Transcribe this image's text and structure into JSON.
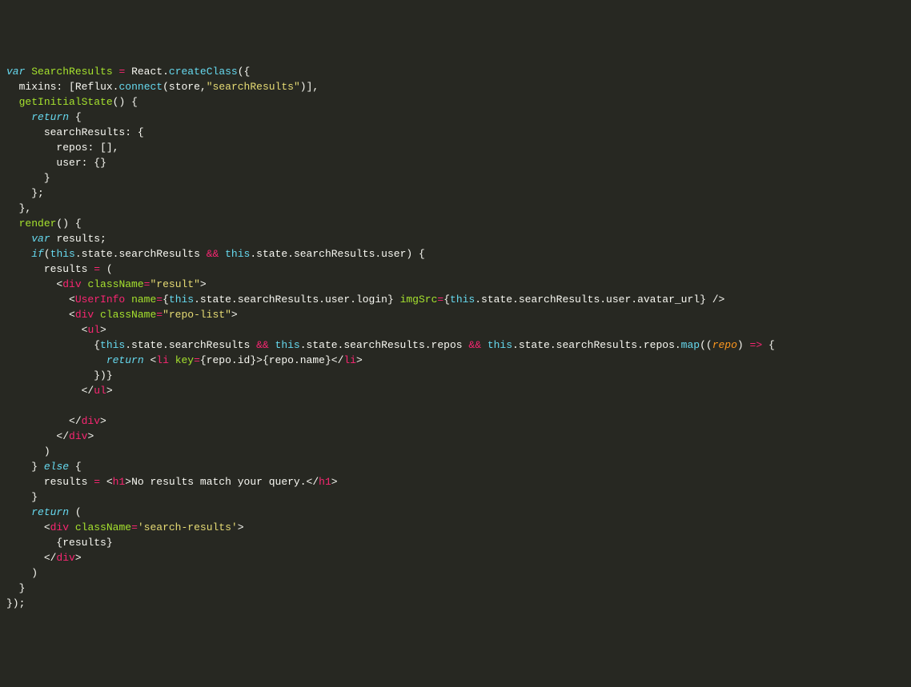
{
  "code": {
    "l1": {
      "var": "var",
      "name": "SearchResults",
      "eq": "=",
      "obj": "React",
      "dot": ".",
      "method": "createClass",
      "open": "({"
    },
    "l2": {
      "key": "mixins",
      "colon": ":",
      "open": "[",
      "obj": "Reflux",
      "dot": ".",
      "method": "connect",
      "p1": "store",
      "comma": ",",
      "str": "\"searchResults\"",
      "close": ")],"
    },
    "l3": {
      "name": "getInitialState",
      "paren": "()",
      "brace": "{"
    },
    "l4": {
      "return": "return",
      "brace": "{"
    },
    "l5": {
      "key": "searchResults",
      "colon": ":",
      "brace": "{"
    },
    "l6": {
      "key": "repos",
      "colon": ":",
      "val": "[],"
    },
    "l7": {
      "key": "user",
      "colon": ":",
      "val": "{}"
    },
    "l8": {
      "brace": "}"
    },
    "l9": {
      "brace": "};"
    },
    "l10": {
      "brace": "},"
    },
    "l11": {
      "name": "render",
      "paren": "()",
      "brace": "{"
    },
    "l12": {
      "var": "var",
      "name": "results",
      "semi": ";"
    },
    "l13": {
      "if": "if",
      "open": "(",
      "this1": "this",
      "p1": ".state.searchResults",
      "amp": "&&",
      "this2": "this",
      "p2": ".state.searchResults.user",
      ") {": ") {"
    },
    "l14": {
      "lhs": "results",
      "eq": "=",
      "open": "("
    },
    "l15": {
      "lt": "<",
      "tag": "div",
      "attr": "className",
      "eq": "=",
      "str": "\"result\"",
      "gt": ">"
    },
    "l16": {
      "lt": "<",
      "tag": "UserInfo",
      "attr1": "name",
      "eq1": "=",
      "b1": "{",
      "this1": "this",
      "p1": ".state.searchResults.user.login}",
      "attr2": "imgSrc",
      "eq2": "=",
      "b2": "{",
      "this2": "this",
      "p2": ".state.searchResults.user.avatar_url}",
      "close": "/>"
    },
    "l17": {
      "lt": "<",
      "tag": "div",
      "attr": "className",
      "eq": "=",
      "str": "\"repo-list\"",
      "gt": ">"
    },
    "l18": {
      "lt": "<",
      "tag": "ul",
      "gt": ">"
    },
    "l19": {
      "open": "{",
      "this1": "this",
      "p1": ".state.searchResults",
      "amp1": "&&",
      "this2": "this",
      "p2": ".state.searchResults.repos",
      "amp2": "&&",
      "this3": "this",
      "p3": ".state.searchResults.repos.",
      "map": "map",
      "paren": "((",
      "param": "repo",
      "close": ")",
      "arrow": "=>",
      "brace": "{"
    },
    "l20": {
      "return": "return",
      "lt": "<",
      "tag": "li",
      "attr": "key",
      "eq": "=",
      "b": "{repo.id}",
      "gt": ">",
      "txt": "{repo.name}",
      "lt2": "</",
      "tag2": "li",
      "gt2": ">"
    },
    "l21": {
      "close": "})}"
    },
    "l22": {
      "lt": "</",
      "tag": "ul",
      "gt": ">"
    },
    "l23": {
      "blank": ""
    },
    "l24": {
      "lt": "</",
      "tag": "div",
      "gt": ">"
    },
    "l25": {
      "lt": "</",
      "tag": "div",
      "gt": ">"
    },
    "l26": {
      "close": ")"
    },
    "l27": {
      "close": "}",
      "else": "else",
      "open": "{"
    },
    "l28": {
      "lhs": "results",
      "eq": "=",
      "lt": "<",
      "tag": "h1",
      "gt": ">",
      "txt": "No results match your query.",
      "lt2": "</",
      "tag2": "h1",
      "gt2": ">"
    },
    "l29": {
      "close": "}"
    },
    "l30": {
      "return": "return",
      "open": "("
    },
    "l31": {
      "lt": "<",
      "tag": "div",
      "attr": "className",
      "eq": "=",
      "str": "'search-results'",
      "gt": ">"
    },
    "l32": {
      "txt": "{results}"
    },
    "l33": {
      "lt": "</",
      "tag": "div",
      "gt": ">"
    },
    "l34": {
      "close": ")"
    },
    "l35": {
      "close": "}"
    },
    "l36": {
      "close": "});"
    }
  }
}
